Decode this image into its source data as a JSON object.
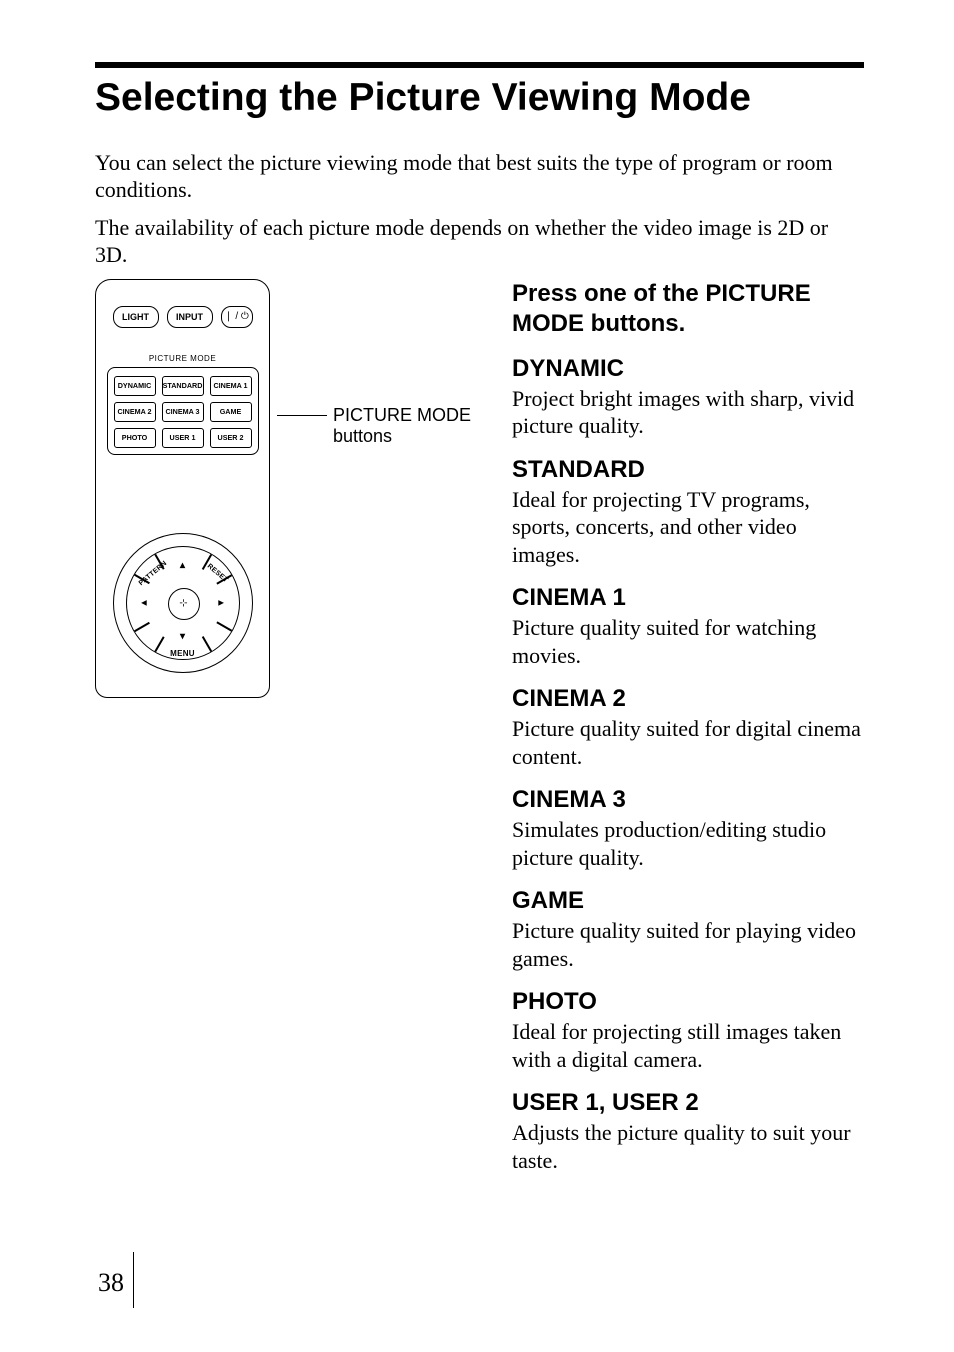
{
  "title": "Selecting the Picture Viewing Mode",
  "intro1": "You can select the picture viewing mode that best suits the type of program or room conditions.",
  "intro2": "The availability of each picture mode depends on whether the video image is 2D or 3D.",
  "remote": {
    "light": "LIGHT",
    "input": "INPUT",
    "power": "❘ / ⏻",
    "section_label": "PICTURE MODE",
    "modes": [
      "DYNAMIC",
      "STANDARD",
      "CINEMA 1",
      "CINEMA 2",
      "CINEMA 3",
      "GAME",
      "PHOTO",
      "USER 1",
      "USER 2"
    ],
    "pattern": "PATTERN",
    "reset": "RESET",
    "menu": "MENU",
    "center": "⊹",
    "arrows": {
      "up": "▴",
      "down": "▾",
      "left": "◂",
      "right": "▸"
    }
  },
  "callout_line1": "PICTURE MODE",
  "callout_line2": "buttons",
  "instruction": "Press one of the PICTURE MODE buttons.",
  "modes": [
    {
      "name": "DYNAMIC",
      "desc": "Project bright images with sharp, vivid picture quality."
    },
    {
      "name": "STANDARD",
      "desc": "Ideal for projecting TV programs, sports, concerts, and other video images."
    },
    {
      "name": "CINEMA 1",
      "desc": "Picture quality suited for watching movies."
    },
    {
      "name": "CINEMA 2",
      "desc": "Picture quality suited for digital cinema content."
    },
    {
      "name": "CINEMA 3",
      "desc": "Simulates production/editing studio picture quality."
    },
    {
      "name": "GAME",
      "desc": "Picture quality suited for playing video games."
    },
    {
      "name": "PHOTO",
      "desc": "Ideal for projecting still images taken with a digital camera."
    },
    {
      "name": "USER 1, USER 2",
      "desc": "Adjusts the picture quality to suit your taste."
    }
  ],
  "page_number": "38"
}
